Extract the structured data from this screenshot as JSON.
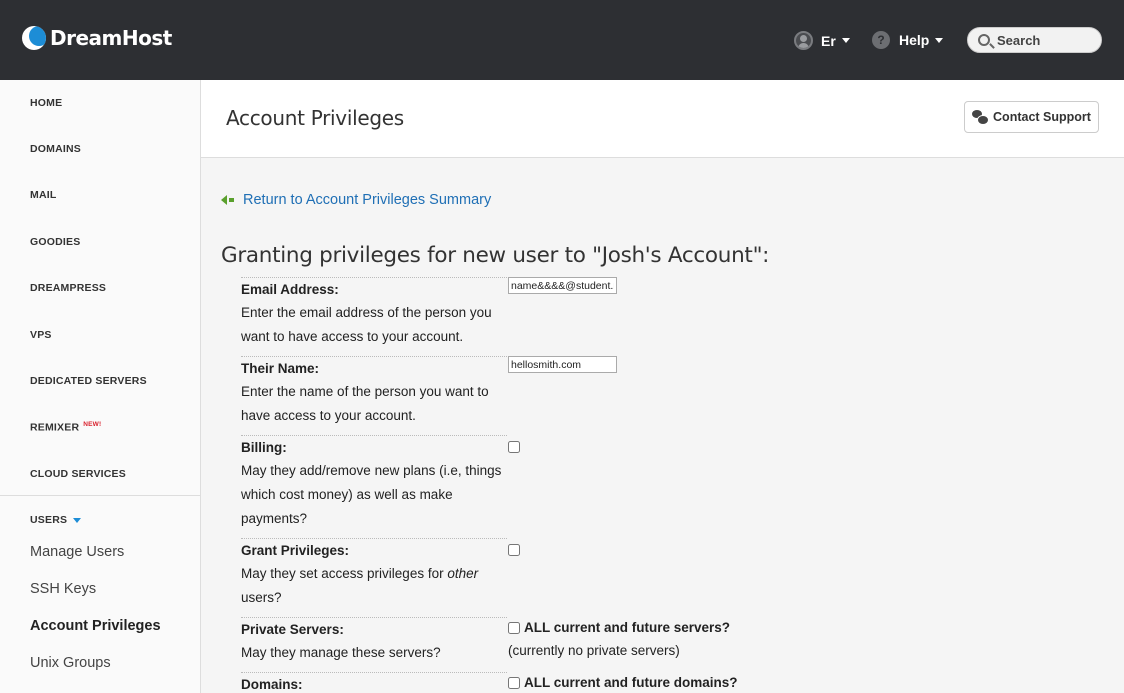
{
  "topbar": {
    "brand": "DreamHost",
    "user_label": "Er",
    "help_label": "Help",
    "search_placeholder": "Search"
  },
  "sidebar": {
    "items": [
      {
        "label": "HOME"
      },
      {
        "label": "DOMAINS"
      },
      {
        "label": "MAIL"
      },
      {
        "label": "GOODIES"
      },
      {
        "label": "DREAMPRESS"
      },
      {
        "label": "VPS"
      },
      {
        "label": "DEDICATED SERVERS"
      },
      {
        "label": "REMIXER",
        "badge": "NEW!"
      },
      {
        "label": "CLOUD SERVICES"
      }
    ],
    "users_section": {
      "label": "USERS",
      "subitems": [
        {
          "label": "Manage Users"
        },
        {
          "label": "SSH Keys"
        },
        {
          "label": "Account Privileges",
          "active": true
        },
        {
          "label": "Unix Groups"
        }
      ]
    }
  },
  "header": {
    "title": "Account Privileges",
    "contact_label": "Contact Support"
  },
  "main": {
    "return_link": "Return to Account Privileges Summary",
    "heading": "Granting privileges for new user to \"Josh's Account\":",
    "fields": {
      "email": {
        "label": "Email Address:",
        "desc": "Enter the email address of the person you want to have access to your account.",
        "value": "name&&&&@student.mail.com"
      },
      "name": {
        "label": "Their Name:",
        "desc": "Enter the name of the person you want to have access to your account.",
        "value": "hellosmith.com"
      },
      "billing": {
        "label": "Billing:",
        "desc": "May they add/remove new plans (i.e, things which cost money) as well as make payments?",
        "checked": false
      },
      "grant": {
        "label": "Grant Privileges:",
        "desc_pre": "May they set access privileges for ",
        "desc_em": "other",
        "desc_post": " users?",
        "checked": false
      },
      "servers": {
        "label": "Private Servers:",
        "desc": "May they manage these servers?",
        "option": "ALL current and future servers?",
        "note": "(currently no private servers)",
        "checked": false
      },
      "domains": {
        "label": "Domains:",
        "option": "ALL current and future domains?",
        "checked": false
      }
    }
  }
}
